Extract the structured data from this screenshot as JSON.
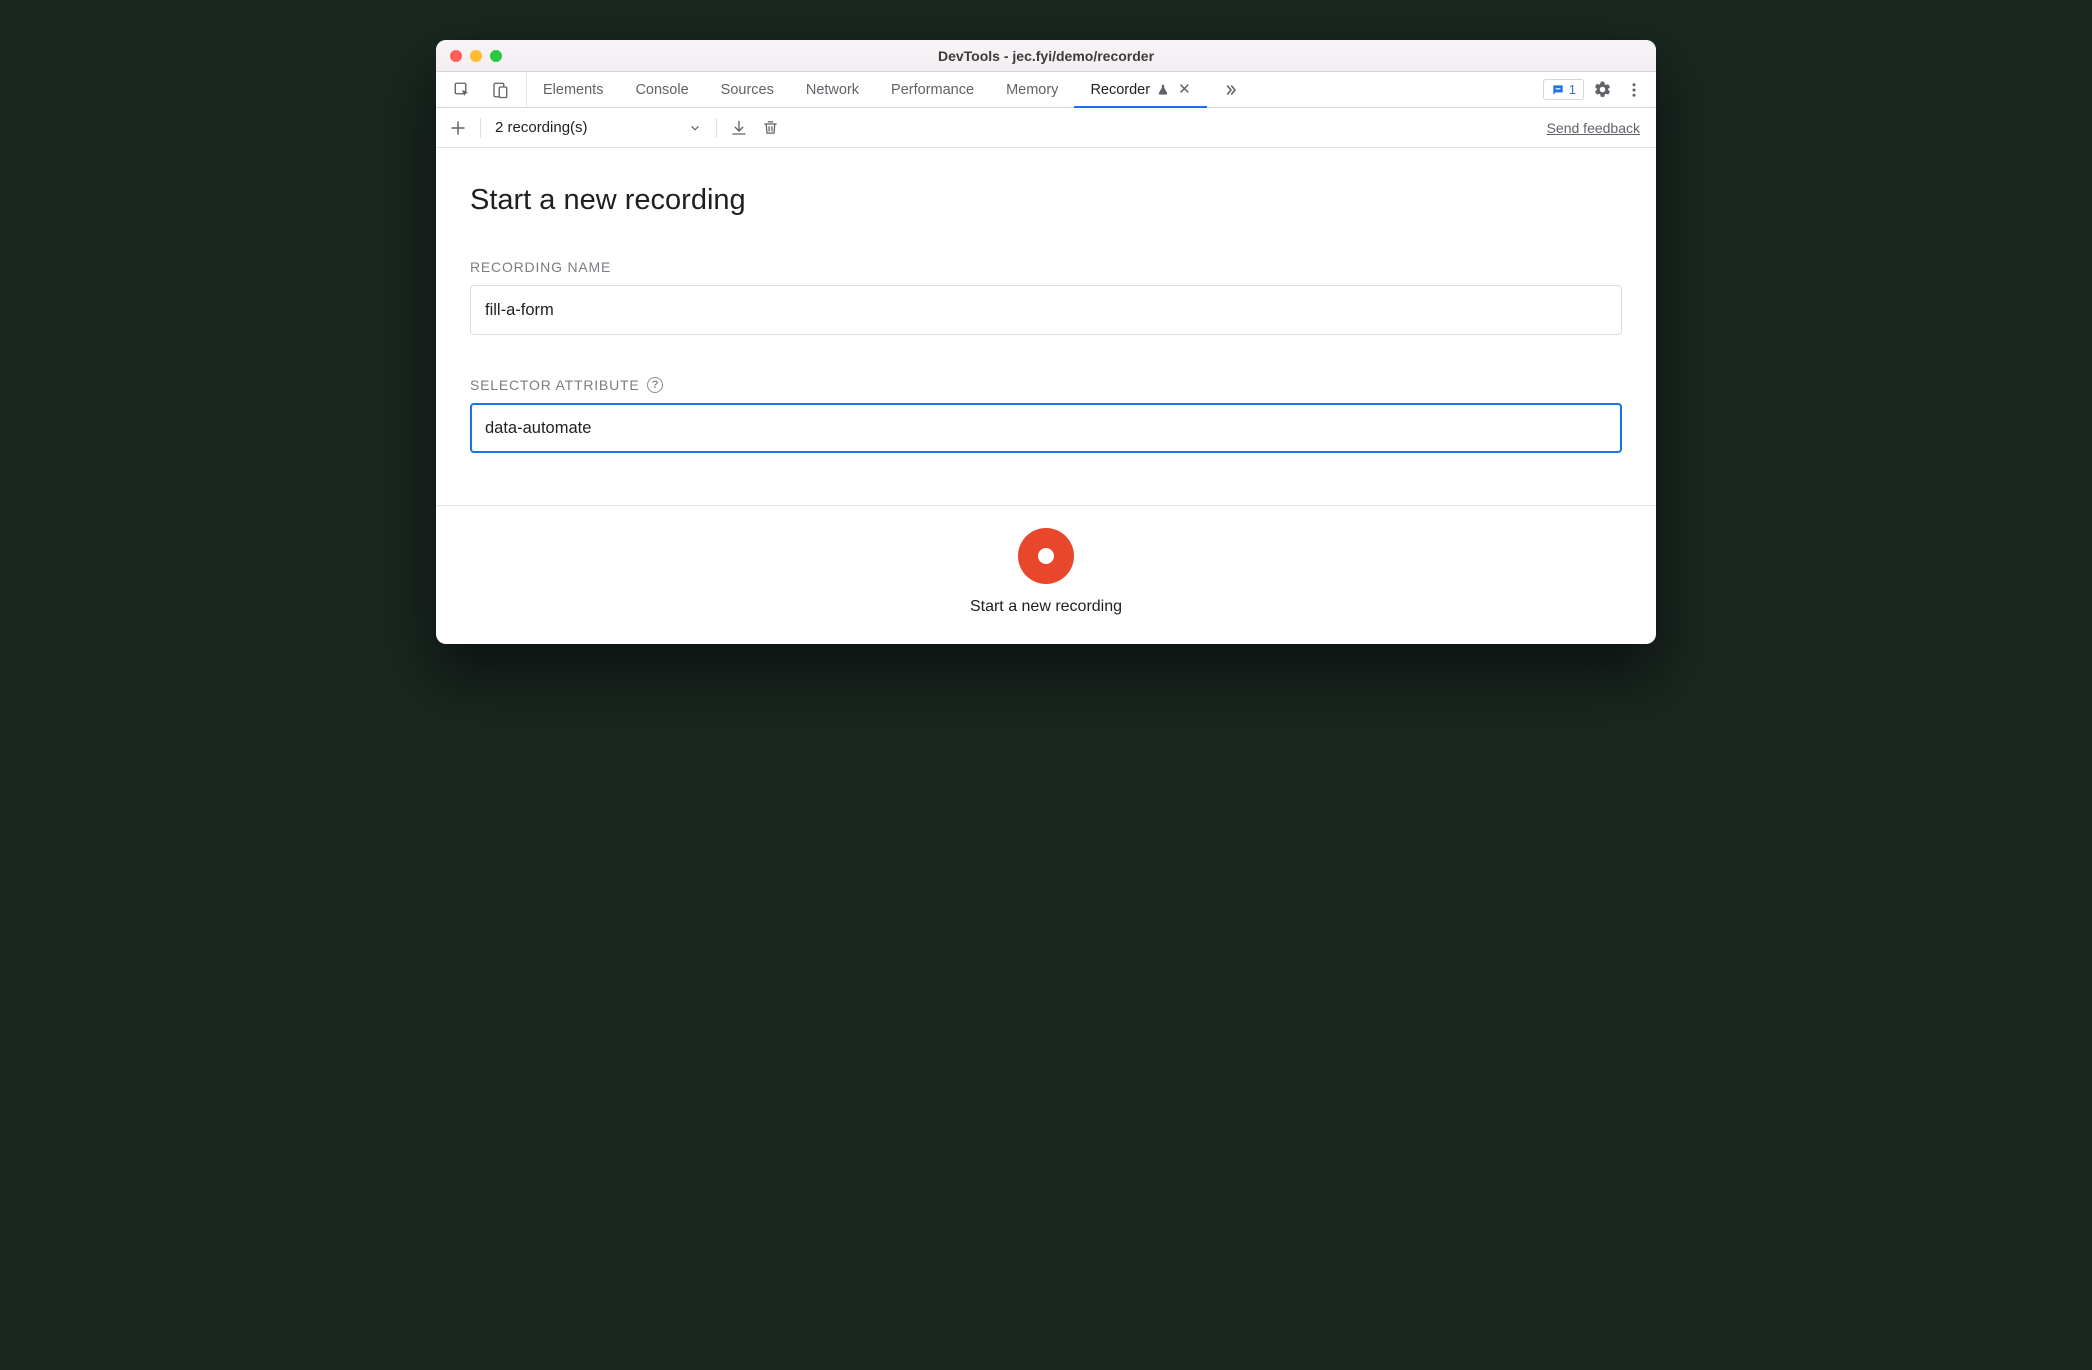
{
  "window": {
    "title": "DevTools - jec.fyi/demo/recorder"
  },
  "tabs": {
    "items": [
      {
        "label": "Elements"
      },
      {
        "label": "Console"
      },
      {
        "label": "Sources"
      },
      {
        "label": "Network"
      },
      {
        "label": "Performance"
      },
      {
        "label": "Memory"
      }
    ],
    "active": {
      "label": "Recorder",
      "experimental": true,
      "closeable": true
    },
    "issues_count": "1"
  },
  "toolbar": {
    "recordings_label": "2 recording(s)",
    "send_feedback": "Send feedback"
  },
  "main": {
    "title": "Start a new recording",
    "recording_name_label": "RECORDING NAME",
    "recording_name_value": "fill-a-form",
    "selector_attr_label": "SELECTOR ATTRIBUTE",
    "selector_attr_value": "data-automate"
  },
  "footer": {
    "start_label": "Start a new recording"
  }
}
